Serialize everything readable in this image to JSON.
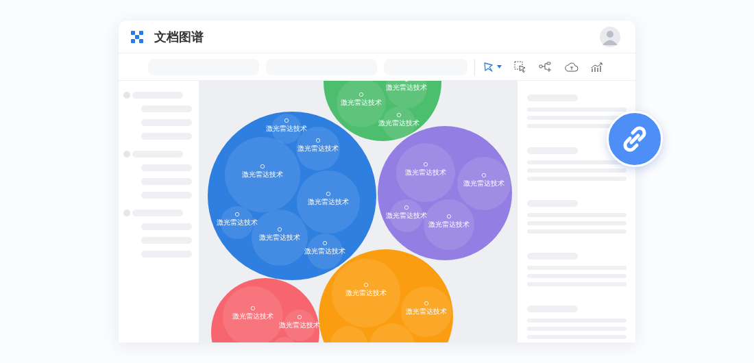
{
  "app": {
    "title": "文档图谱"
  },
  "clusters": [
    {
      "color": "#4dbd6e",
      "nodes": [
        {
          "label": "激光雷达技术"
        },
        {
          "label": "激光雷达技术"
        },
        {
          "label": "激光雷达技术"
        }
      ]
    },
    {
      "color": "#2f7fe0",
      "nodes": [
        {
          "label": "激光雷达技术"
        },
        {
          "label": "激光雷达技术"
        },
        {
          "label": "激光雷达技术"
        },
        {
          "label": "激光雷达技术"
        },
        {
          "label": "激光雷达技术"
        },
        {
          "label": "激光雷达技术"
        },
        {
          "label": "激光雷达技术"
        }
      ]
    },
    {
      "color": "#937fe3",
      "nodes": [
        {
          "label": "激光雷达技术"
        },
        {
          "label": "激光雷达技术"
        },
        {
          "label": "激光雷达技术"
        },
        {
          "label": "激光雷达技术"
        }
      ]
    },
    {
      "color": "#fb9d10",
      "nodes": [
        {
          "label": "激光雷达技术"
        },
        {
          "label": "激光雷达技术"
        }
      ]
    },
    {
      "color": "#f7666f",
      "nodes": [
        {
          "label": "激光雷达技术"
        },
        {
          "label": "激光雷达技术"
        }
      ]
    }
  ]
}
